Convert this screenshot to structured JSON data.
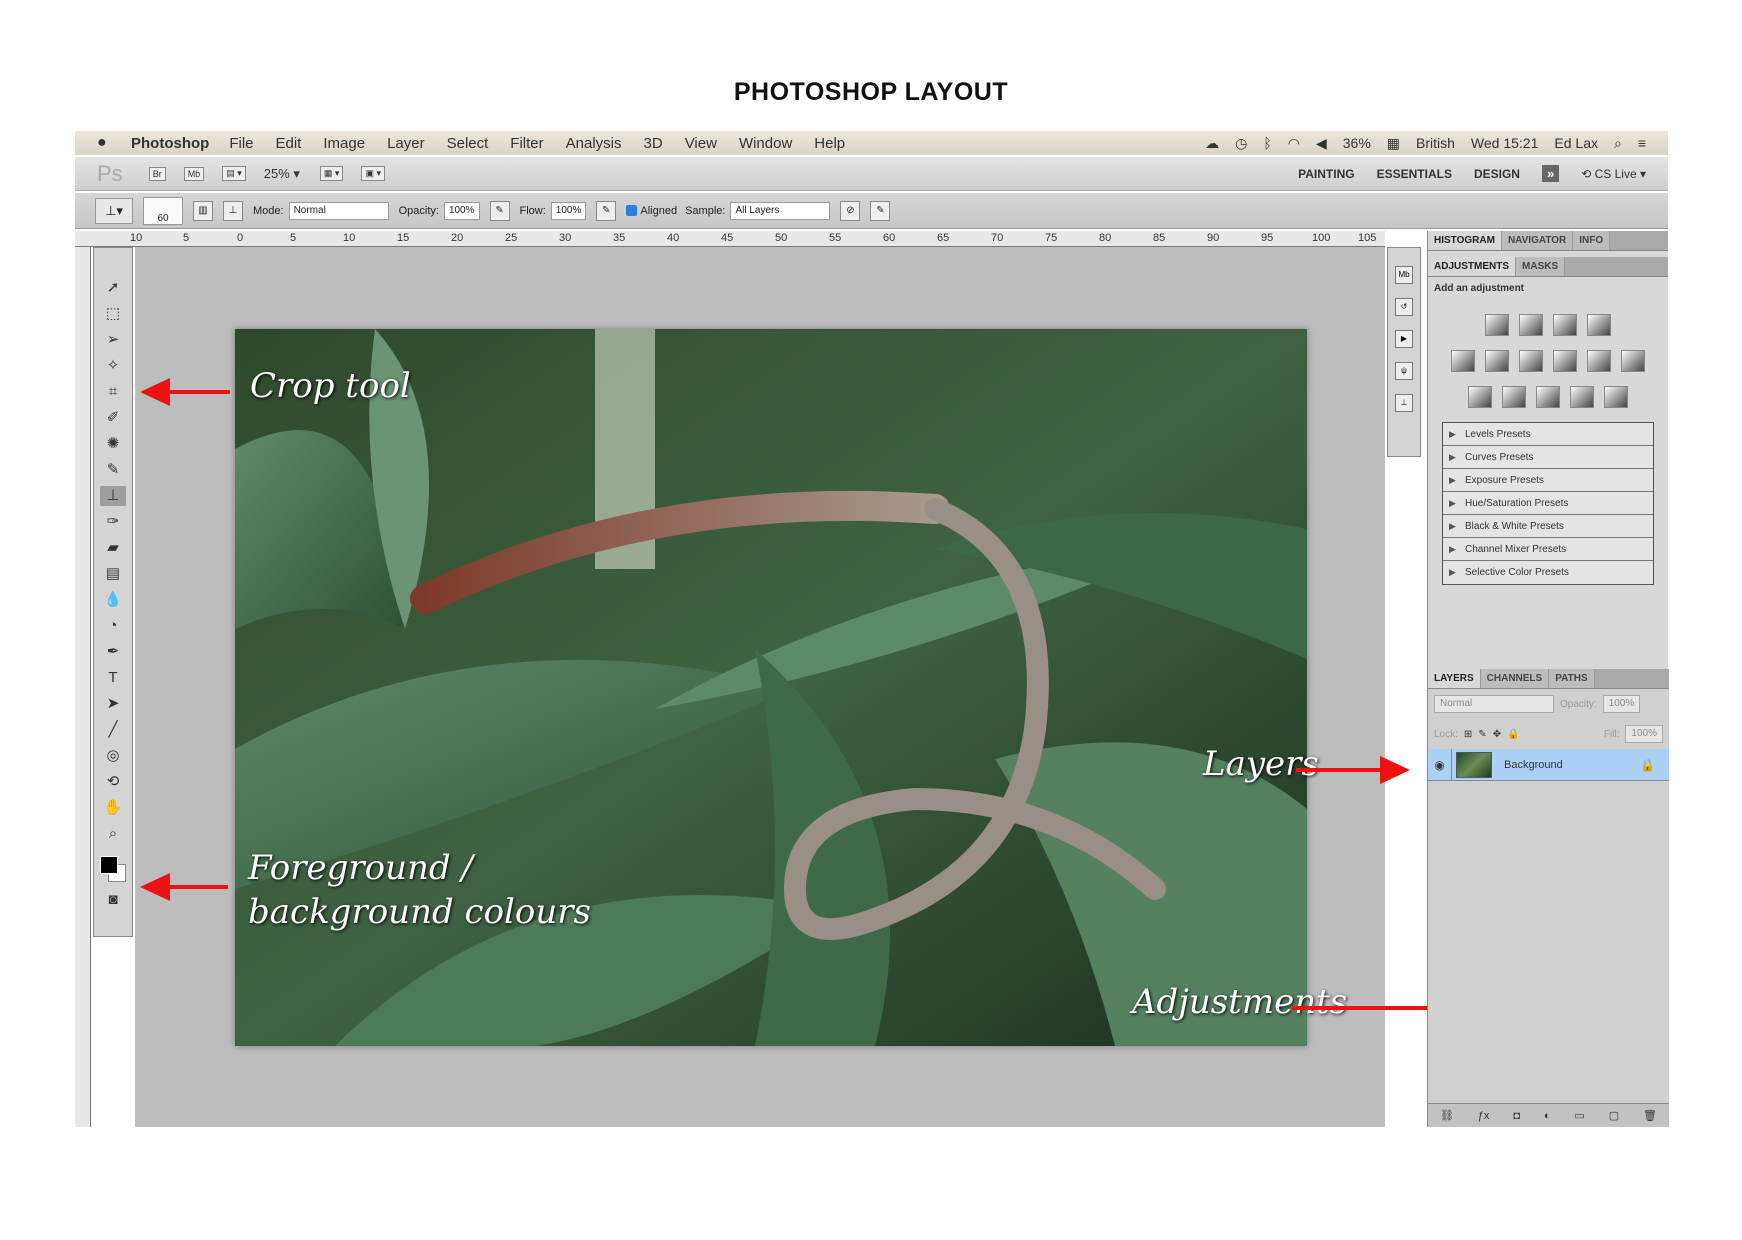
{
  "page_title": "PHOTOSHOP LAYOUT",
  "menubar": {
    "apple": "",
    "app": "Photoshop",
    "items": [
      "File",
      "Edit",
      "Image",
      "Layer",
      "Select",
      "Filter",
      "Analysis",
      "3D",
      "View",
      "Window",
      "Help"
    ],
    "status": {
      "battery": "36%",
      "language": "British",
      "clock": "Wed 15:21",
      "user": "Ed Lax"
    }
  },
  "appbar": {
    "logo": "Ps",
    "br": "Br",
    "mb": "Mb",
    "zoom": "25%",
    "workspaces": [
      "PAINTING",
      "ESSENTIALS",
      "DESIGN"
    ],
    "more": "»",
    "cs_live": "CS Live"
  },
  "options": {
    "brush_size": "60",
    "mode_label": "Mode:",
    "mode_value": "Normal",
    "opacity_label": "Opacity:",
    "opacity_value": "100%",
    "flow_label": "Flow:",
    "flow_value": "100%",
    "aligned_label": "Aligned",
    "sample_label": "Sample:",
    "sample_value": "All Layers"
  },
  "ruler": {
    "top": [
      "10",
      "5",
      "0",
      "5",
      "10",
      "15",
      "20",
      "25",
      "30",
      "35",
      "40",
      "45",
      "50",
      "55",
      "60",
      "65",
      "70",
      "75",
      "80",
      "85",
      "90",
      "95",
      "100",
      "105"
    ]
  },
  "annotations": {
    "crop": "Crop tool",
    "colors_line1": "Foreground /",
    "colors_line2": "background colours",
    "layers": "Layers",
    "adjustments": "Adjustments"
  },
  "panels": {
    "top_tabs": [
      "HISTOGRAM",
      "NAVIGATOR",
      "INFO"
    ],
    "adj_tabs": [
      "ADJUSTMENTS",
      "MASKS"
    ],
    "adj_title": "Add an adjustment",
    "presets": [
      "Levels Presets",
      "Curves Presets",
      "Exposure Presets",
      "Hue/Saturation Presets",
      "Black & White Presets",
      "Channel Mixer Presets",
      "Selective Color Presets"
    ],
    "layer_tabs": [
      "LAYERS",
      "CHANNELS",
      "PATHS"
    ],
    "blend_mode": "Normal",
    "opacity_label": "Opacity:",
    "opacity_value": "100%",
    "lock_label": "Lock:",
    "fill_label": "Fill:",
    "fill_value": "100%",
    "layer_name": "Background"
  },
  "colors": {
    "arrow": "#e11111",
    "selected_layer": "#abd2f6"
  }
}
